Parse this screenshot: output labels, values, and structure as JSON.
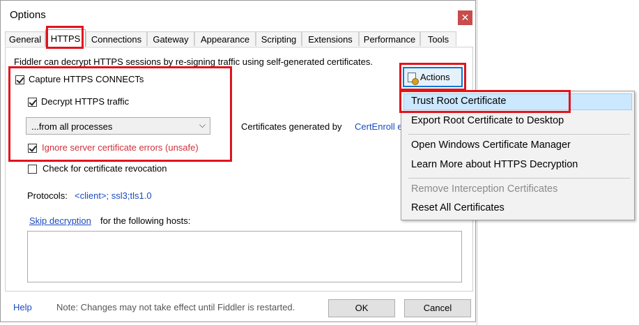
{
  "window": {
    "title": "Options",
    "close_glyph": "✕"
  },
  "tabs": [
    {
      "label": "General"
    },
    {
      "label": "HTTPS"
    },
    {
      "label": "Connections"
    },
    {
      "label": "Gateway"
    },
    {
      "label": "Appearance"
    },
    {
      "label": "Scripting"
    },
    {
      "label": "Extensions"
    },
    {
      "label": "Performance"
    },
    {
      "label": "Tools"
    }
  ],
  "https": {
    "intro": "Fiddler can decrypt HTTPS sessions by re-signing traffic using self-generated certificates.",
    "capture_connects": {
      "label": "Capture HTTPS CONNECTs",
      "checked": true
    },
    "decrypt_traffic": {
      "label": "Decrypt HTTPS traffic",
      "checked": true
    },
    "process_filter": {
      "selected": "...from all processes"
    },
    "ignore_errors": {
      "label": "Ignore server certificate errors (unsafe)",
      "checked": true,
      "color": "#d0303a"
    },
    "check_revocation": {
      "label": "Check for certificate revocation",
      "checked": false
    },
    "cert_generated_prefix": "Certificates generated by",
    "cert_generator_link": "CertEnroll e",
    "protocols_label": "Protocols:",
    "protocols_value": "<client>; ssl3;tls1.0",
    "skip_link": "Skip decryption",
    "skip_suffix": "for the following hosts:",
    "hosts_value": ""
  },
  "actions_button": {
    "label": "Actions",
    "icon": "certificate-icon"
  },
  "actions_menu": {
    "items": [
      {
        "label": "Trust Root Certificate",
        "highlighted": true
      },
      {
        "label": "Export Root Certificate to Desktop"
      },
      {
        "label": "Open Windows Certificate Manager"
      },
      {
        "label": "Learn More about HTTPS Decryption"
      },
      {
        "label": "Remove Interception Certificates",
        "disabled": true
      },
      {
        "label": "Reset All Certificates"
      }
    ]
  },
  "footer": {
    "help": "Help",
    "note": "Note: Changes may not take effect until Fiddler is restarted.",
    "ok": "OK",
    "cancel": "Cancel"
  },
  "colors": {
    "annotation_red": "#e0141c",
    "link_blue": "#1a4bbf",
    "menu_highlight": "#cce8ff",
    "focus_blue": "#0078d7"
  }
}
